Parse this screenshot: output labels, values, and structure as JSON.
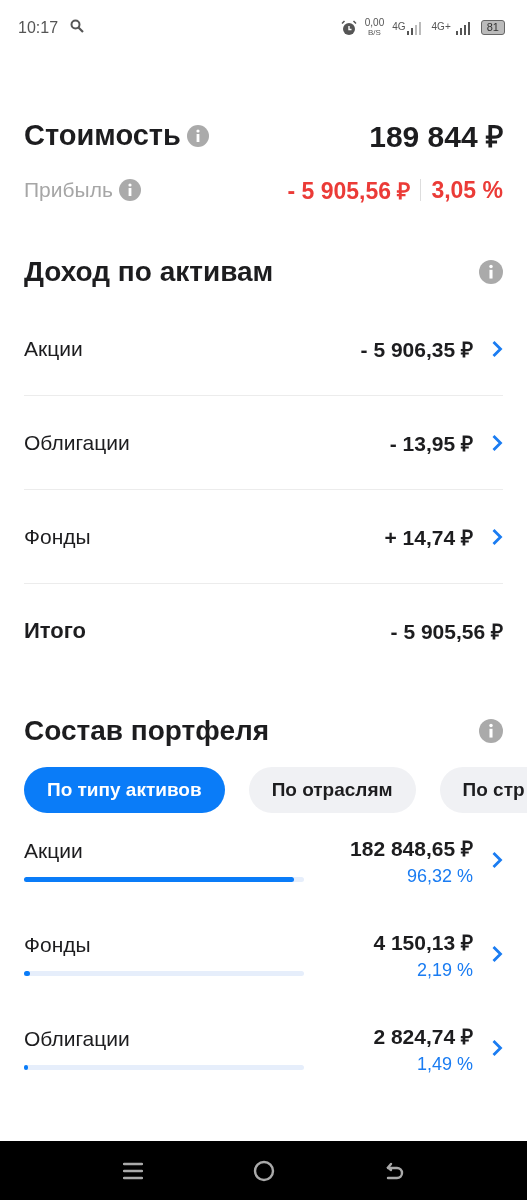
{
  "status_bar": {
    "time": "10:17",
    "speed": "0,00",
    "speed_unit": "B/S",
    "network_1": "4G",
    "network_2": "4G+",
    "battery": "81"
  },
  "summary": {
    "value_label": "Стоимость",
    "value": "189 844 ₽",
    "profit_label": "Прибыль",
    "profit": "- 5 905,56 ₽",
    "profit_percent": "3,05 %"
  },
  "income": {
    "title": "Доход по активам",
    "rows": [
      {
        "label": "Акции",
        "value": "- 5 906,35 ₽",
        "kind": "link"
      },
      {
        "label": "Облигации",
        "value": "- 13,95 ₽",
        "kind": "link"
      },
      {
        "label": "Фонды",
        "value": "+ 14,74 ₽",
        "kind": "link"
      },
      {
        "label": "Итого",
        "value": "- 5 905,56 ₽",
        "kind": "total"
      }
    ]
  },
  "composition": {
    "title": "Состав портфеля",
    "tabs": [
      {
        "label": "По типу активов",
        "selected": true
      },
      {
        "label": "По отраслям",
        "selected": false
      },
      {
        "label": "По стр",
        "selected": false
      }
    ],
    "rows": [
      {
        "label": "Акции",
        "value": "182 848,65 ₽",
        "percent": "96,32 %",
        "level": 0.9632
      },
      {
        "label": "Фонды",
        "value": "4 150,13 ₽",
        "percent": "2,19 %",
        "level": 0.0219
      },
      {
        "label": "Облигации",
        "value": "2 824,74 ₽",
        "percent": "1,49 %",
        "level": 0.0149
      }
    ]
  }
}
